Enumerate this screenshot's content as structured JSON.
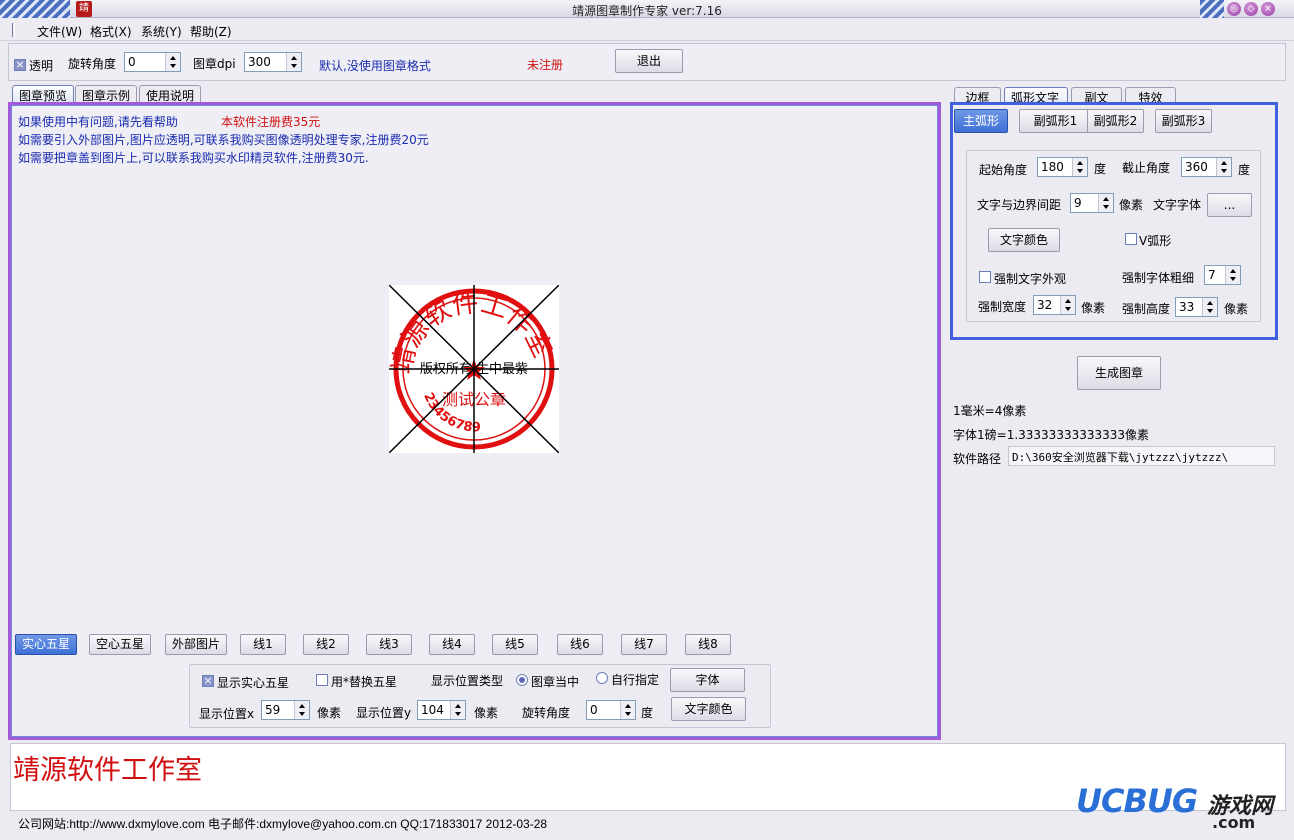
{
  "window": {
    "title": "靖源图章制作专家 ver:7.16",
    "logo_char": "靖",
    "btn_minimize": "◎",
    "btn_maximize": "◇",
    "btn_close": "×"
  },
  "menu": [
    "文件(W)",
    "格式(X)",
    "系统(Y)",
    "帮助(Z)"
  ],
  "toolbar": {
    "transparent_label": "透明",
    "rotate_label": "旋转角度",
    "rotate_value": "0",
    "dpi_label": "图章dpi",
    "dpi_value": "300",
    "default_text": "默认,没使用图章格式",
    "unregistered": "未注册",
    "exit_button": "退出"
  },
  "left_tabs": [
    "图章预览",
    "图章示例",
    "使用说明"
  ],
  "info": {
    "line1": "如果使用中有问题,请先看帮助",
    "fee": "本软件注册费35元",
    "line2": "如需要引入外部图片,图片应透明,可联系我购买图像透明处理专家,注册费20元",
    "line3": "如需要把章盖到图片上,可以联系我购买水印精灵软件,注册费30元."
  },
  "stamp": {
    "arc_text": "靖源软件工作室",
    "middle_text": "版权所有 生中最紫",
    "bottom_text": "测试公章",
    "numbers": "23456789",
    "color": "#e01010"
  },
  "star_buttons": [
    "实心五星",
    "空心五星",
    "外部图片",
    "线1",
    "线2",
    "线3",
    "线4",
    "线5",
    "线6",
    "线7",
    "线8"
  ],
  "star_options": {
    "show_solid": "显示实心五星",
    "replace_star": "用*替换五星",
    "pos_type": "显示位置类型",
    "center": "图章当中",
    "custom": "自行指定",
    "font_button": "字体",
    "pos_x_label": "显示位置x",
    "pos_x_value": "59",
    "pixel1": "像素",
    "pos_y_label": "显示位置y",
    "pos_y_value": "104",
    "pixel2": "像素",
    "rotate_label": "旋转角度",
    "rotate_value": "0",
    "degree": "度",
    "text_color_button": "文字颜色"
  },
  "right_tabs": [
    "边框",
    "弧形文字",
    "副文",
    "特效"
  ],
  "arc_tabs": [
    "主弧形",
    "副弧形1",
    "副弧形2",
    "副弧形3"
  ],
  "arc_settings": {
    "start_angle_label": "起始角度",
    "start_angle_value": "180",
    "degree1": "度",
    "end_angle_label": "截止角度",
    "end_angle_value": "360",
    "degree2": "度",
    "margin_label": "文字与边界间距",
    "margin_value": "9",
    "pixel": "像素",
    "font_label": "文字字体",
    "font_button": "...",
    "color_button": "文字颜色",
    "v_arc": "V弧形",
    "force_look": "强制文字外观",
    "force_weight_label": "强制字体粗细",
    "force_weight_value": "7",
    "force_width_label": "强制宽度",
    "force_width_value": "32",
    "pixel_w": "像素",
    "force_height_label": "强制高度",
    "force_height_value": "33",
    "pixel_h": "像素"
  },
  "generate_button": "生成图章",
  "mm_info": "1毫米=4像素",
  "pt_info": "字体1磅=1.33333333333333像素",
  "path_label": "软件路径",
  "path_value": "D:\\360安全浏览器下载\\jytzzz\\jytzzz\\",
  "bottom_text": "靖源软件工作室",
  "status": "公司网站:http://www.dxmylove.com 电子邮件:dxmylove@yahoo.com.cn QQ:171833017  2012-03-28",
  "watermark": {
    "brand": "UCBUG",
    "cn": "游戏网",
    "domain": ".com"
  }
}
